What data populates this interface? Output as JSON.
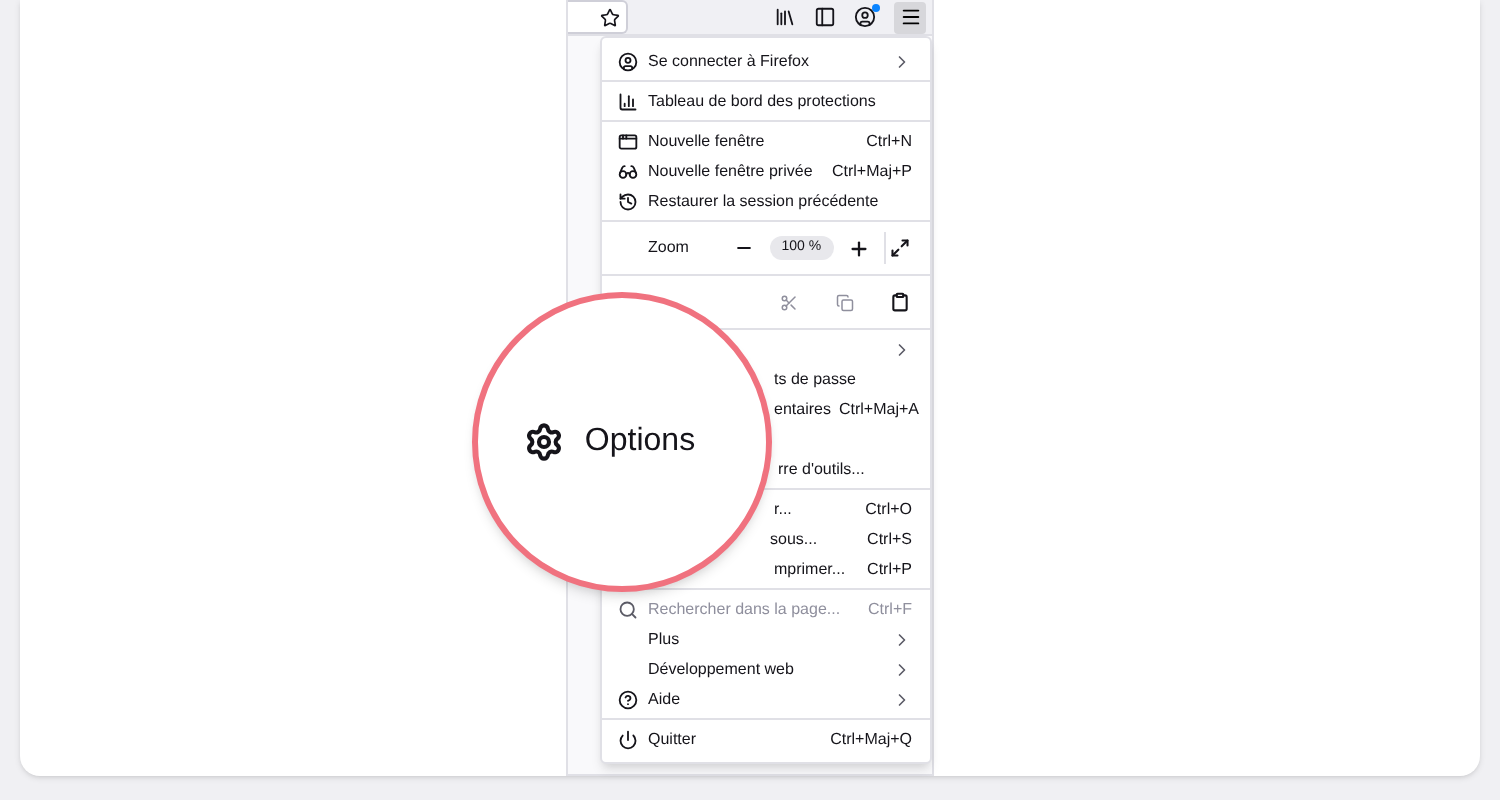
{
  "lens": {
    "label": "Options"
  },
  "menu": [
    [
      {
        "kind": "item",
        "label": "Se connecter à Firefox",
        "submenu": true
      }
    ],
    [
      {
        "kind": "item",
        "label": "Tableau de bord des protections"
      }
    ],
    [
      {
        "kind": "item",
        "label": "Nouvelle fenêtre",
        "shortcut": "Ctrl+N"
      },
      {
        "kind": "item",
        "label": "Nouvelle fenêtre privée",
        "shortcut": "Ctrl+Maj+P"
      },
      {
        "kind": "item",
        "label": "Restaurer la session précédente"
      }
    ],
    [
      {
        "kind": "zoom",
        "label": "Zoom",
        "value": "100 %"
      }
    ],
    [
      {
        "kind": "edit"
      }
    ],
    [
      {
        "kind": "item",
        "submenu": true
      },
      {
        "kind": "item",
        "label": "ts de passe"
      },
      {
        "kind": "item",
        "label": "entaires",
        "shortcut": "Ctrl+Maj+A"
      },
      {
        "kind": "covered"
      },
      {
        "kind": "item",
        "label": "rre d'outils..."
      }
    ],
    [
      {
        "kind": "item",
        "label": "r...",
        "shortcut": "Ctrl+O"
      },
      {
        "kind": "item",
        "label": "sous...",
        "shortcut": "Ctrl+S"
      },
      {
        "kind": "item",
        "label": "mprimer...",
        "shortcut": "Ctrl+P"
      }
    ],
    [
      {
        "kind": "item",
        "label": "Rechercher dans la page...",
        "shortcut": "Ctrl+F",
        "disabled": true
      },
      {
        "kind": "item",
        "label": "Plus",
        "submenu": true
      },
      {
        "kind": "item",
        "label": "Développement web",
        "submenu": true
      },
      {
        "kind": "item",
        "label": "Aide",
        "submenu": true
      }
    ],
    [
      {
        "kind": "item",
        "label": "Quitter",
        "shortcut": "Ctrl+Maj+Q"
      }
    ]
  ]
}
